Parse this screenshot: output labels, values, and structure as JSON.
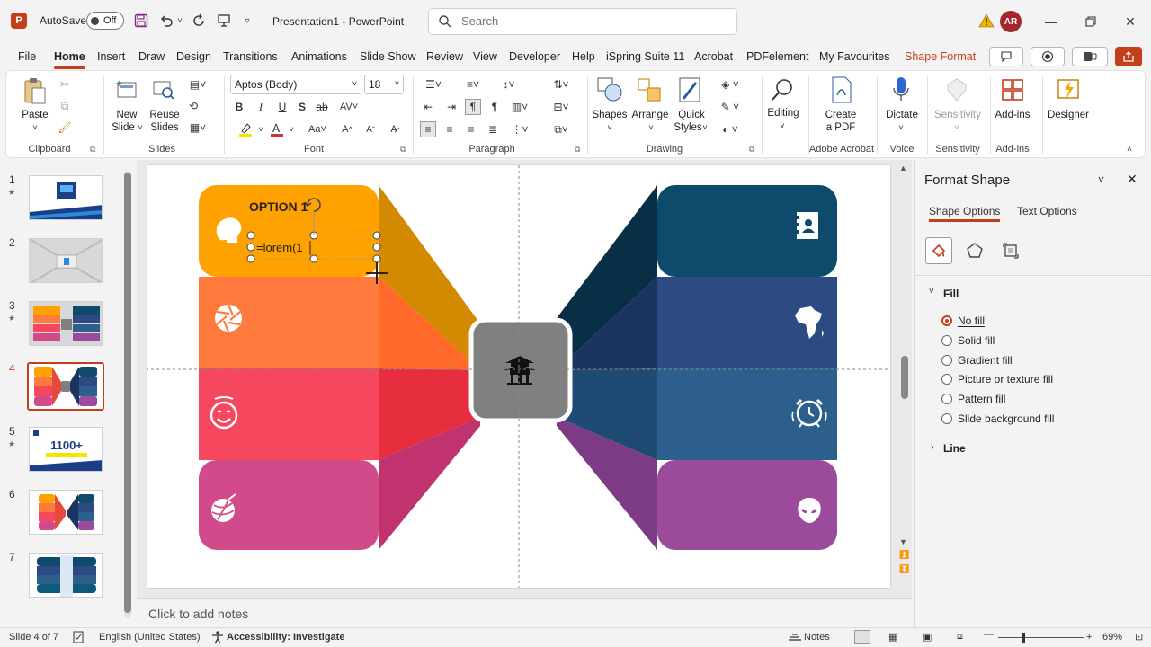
{
  "titlebar": {
    "app_logo": "P",
    "autosave_label": "AutoSave",
    "autosave_state": "Off",
    "doc_title": "Presentation1  -  PowerPoint",
    "search_placeholder": "Search",
    "user_initials": "AR",
    "icons": [
      "save-icon",
      "undo-icon",
      "redo-icon",
      "present-icon",
      "customize-icon",
      "warning-icon",
      "minimize-icon",
      "restore-icon",
      "close-icon"
    ]
  },
  "menu": {
    "tabs": [
      "File",
      "Home",
      "Insert",
      "Draw",
      "Design",
      "Transitions",
      "Animations",
      "Slide Show",
      "Review",
      "View",
      "Developer",
      "Help",
      "iSpring Suite 11",
      "Acrobat",
      "PDFelement",
      "My Favourites",
      "Shape Format"
    ],
    "active": "Home",
    "accent_tab": "Shape Format"
  },
  "ribbon": {
    "clipboard": {
      "label": "Clipboard",
      "paste": "Paste"
    },
    "slides": {
      "label": "Slides",
      "new_slide_1": "New",
      "new_slide_2": "Slide",
      "reuse_1": "Reuse",
      "reuse_2": "Slides"
    },
    "font": {
      "label": "Font",
      "font_name": "Aptos (Body)",
      "font_size": "18"
    },
    "paragraph": {
      "label": "Paragraph"
    },
    "drawing": {
      "label": "Drawing",
      "shapes": "Shapes",
      "arrange": "Arrange",
      "quick_1": "Quick",
      "quick_2": "Styles"
    },
    "editing": {
      "label": "Editing"
    },
    "adobe": {
      "label": "Adobe Acrobat",
      "create_1": "Create",
      "create_2": "a PDF"
    },
    "voice": {
      "label": "Voice",
      "dictate": "Dictate"
    },
    "sensitivity": {
      "label": "Sensitivity",
      "button": "Sensitivity"
    },
    "addins": {
      "label": "Add-ins",
      "button": "Add-ins"
    },
    "designer": {
      "button": "Designer"
    }
  },
  "thumbnails": [
    {
      "num": "1",
      "star": "★"
    },
    {
      "num": "2",
      "star": ""
    },
    {
      "num": "3",
      "star": "★"
    },
    {
      "num": "4",
      "star": ""
    },
    {
      "num": "5",
      "star": "★"
    },
    {
      "num": "6",
      "star": ""
    },
    {
      "num": "7",
      "star": ""
    }
  ],
  "active_slide": "4",
  "thumb5_text": "1100+",
  "slide": {
    "option_title": "OPTION 1",
    "textbox_value": "=lorem(1",
    "left_colors": [
      "#ffa200",
      "#ff7a3d",
      "#f5485e",
      "#d14b8a"
    ],
    "left_side_colors": [
      "#d48a00",
      "#ff6a2a",
      "#e62e3e",
      "#c0336e"
    ],
    "right_colors": [
      "#0d4a6b",
      "#2c4b83",
      "#2c5f8b",
      "#9b4a9c"
    ],
    "right_side_colors": [
      "#082f45",
      "#1c3560",
      "#1f4a74",
      "#7d3a85"
    ],
    "center_color": "#808080",
    "left_icons": [
      "brain-icon",
      "aperture-icon",
      "smile-icon",
      "yarn-icon"
    ],
    "right_icons": [
      "contact-card-icon",
      "africa-icon",
      "alarm-clock-icon",
      "alien-icon"
    ],
    "center_icon": "pagoda-icon"
  },
  "notes_placeholder": "Click to add notes",
  "format_pane": {
    "title": "Format Shape",
    "tab_shape": "Shape Options",
    "tab_text": "Text Options",
    "fill_section": "Fill",
    "line_section": "Line",
    "fill_options": [
      "No fill",
      "Solid fill",
      "Gradient fill",
      "Picture or texture fill",
      "Pattern fill",
      "Slide background fill"
    ],
    "fill_selected": "No fill"
  },
  "statusbar": {
    "slide_info": "Slide 4 of 7",
    "language": "English (United States)",
    "accessibility": "Accessibility: Investigate",
    "notes": "Notes",
    "zoom": "69%"
  },
  "theme": {
    "accent": "#c43e1c"
  }
}
